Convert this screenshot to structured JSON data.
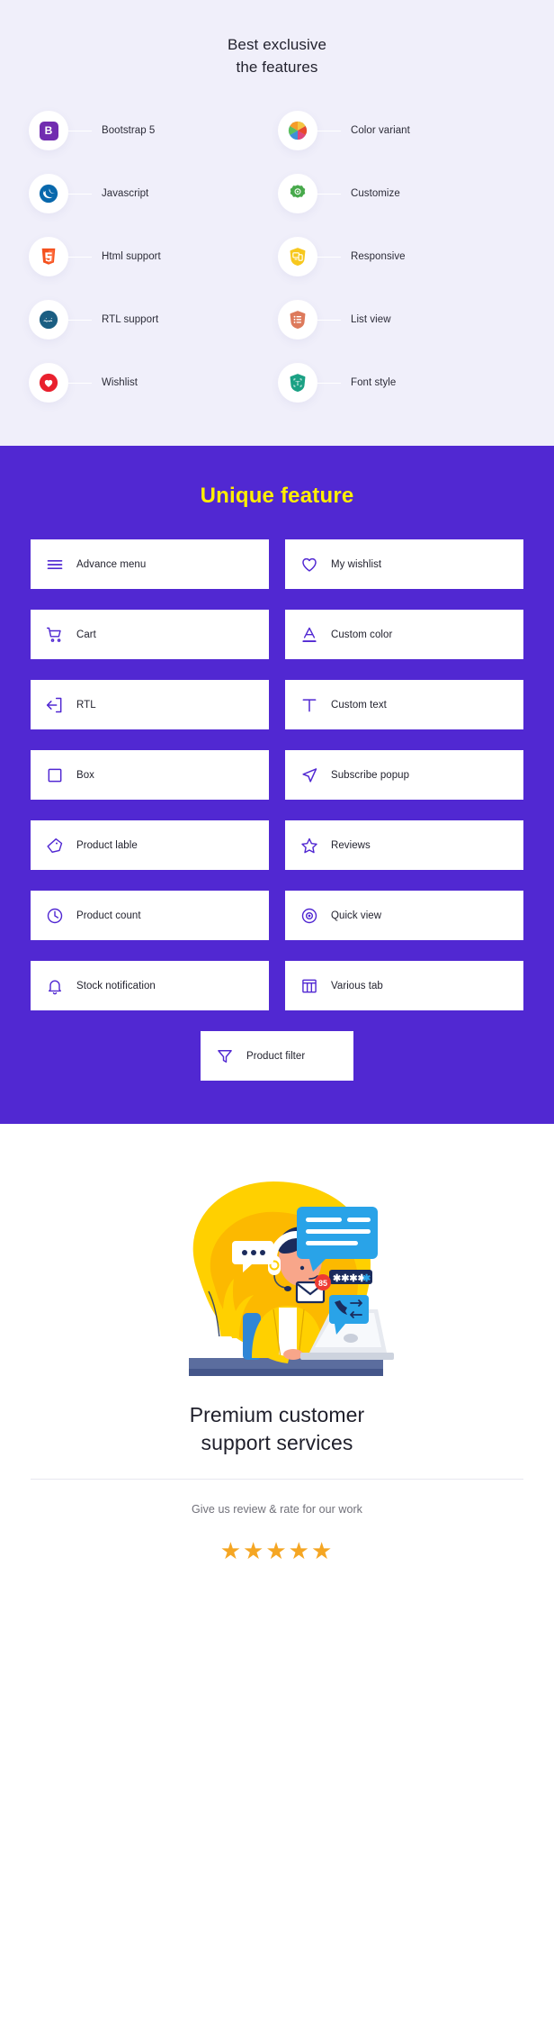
{
  "exclusive": {
    "heading_line1": "Best exclusive",
    "heading_line2": "the features",
    "background": "#f0effa",
    "items": [
      {
        "label": "Bootstrap 5",
        "icon": "bootstrap-icon",
        "color": "#712cb0"
      },
      {
        "label": "Color variant",
        "icon": "color-wheel-icon",
        "color": "#4aa3e0"
      },
      {
        "label": "Javascript",
        "icon": "jquery-icon",
        "color": "#0868ac"
      },
      {
        "label": "Customize",
        "icon": "gear-icon",
        "color": "#47a94b"
      },
      {
        "label": "Html support",
        "icon": "html5-icon",
        "color": "#f4511e"
      },
      {
        "label": "Responsive",
        "icon": "devices-icon",
        "color": "#f7c81e"
      },
      {
        "label": "RTL support",
        "icon": "rtl-icon",
        "color": "#1b5e82"
      },
      {
        "label": "List view",
        "icon": "list-icon",
        "color": "#dd7a5c"
      },
      {
        "label": "Wishlist",
        "icon": "heart-icon",
        "color": "#e9212e"
      },
      {
        "label": "Font style",
        "icon": "font-style-icon",
        "color": "#1ba184"
      }
    ]
  },
  "unique": {
    "heading": "Unique feature",
    "background": "#5128d2",
    "heading_color": "#ffee00",
    "icon_color": "#5128d2",
    "cards": [
      {
        "label": "Advance menu",
        "icon": "hamburger-menu-icon"
      },
      {
        "label": "My wishlist",
        "icon": "heart-outline-icon"
      },
      {
        "label": "Cart",
        "icon": "shopping-cart-icon"
      },
      {
        "label": "Custom color",
        "icon": "underline-a-icon"
      },
      {
        "label": "RTL",
        "icon": "arrow-left-exit-icon"
      },
      {
        "label": "Custom text",
        "icon": "text-t-icon"
      },
      {
        "label": "Box",
        "icon": "square-box-icon"
      },
      {
        "label": "Subscribe popup",
        "icon": "send-paper-plane-icon"
      },
      {
        "label": "Product lable",
        "icon": "tag-label-icon"
      },
      {
        "label": "Reviews",
        "icon": "star-outline-icon"
      },
      {
        "label": "Product count",
        "icon": "clock-icon"
      },
      {
        "label": "Quick view",
        "icon": "eye-target-icon"
      },
      {
        "label": "Stock notification",
        "icon": "bell-icon"
      },
      {
        "label": "Various tab",
        "icon": "table-columns-icon"
      }
    ],
    "last_card": {
      "label": "Product filter",
      "icon": "funnel-filter-icon"
    }
  },
  "support": {
    "title_line1": "Premium customer",
    "title_line2": "support services",
    "subtitle": "Give us review & rate for our work",
    "rating": 5,
    "star_glyph": "★",
    "star_color": "#f5a623",
    "illustration": "customer-support-agent-illustration"
  }
}
